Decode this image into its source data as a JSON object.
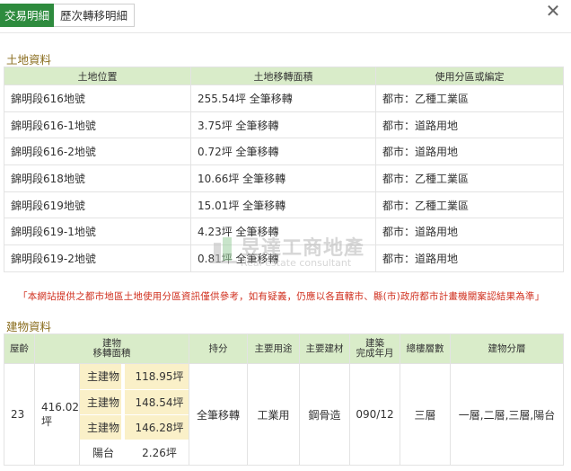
{
  "tabs": [
    {
      "label": "交易明細",
      "active": true
    },
    {
      "label": "歷次轉移明細",
      "active": false
    }
  ],
  "close_icon": "close-icon",
  "land_section": {
    "title": "土地資料",
    "columns": [
      "土地位置",
      "土地移轉面積",
      "使用分區或編定"
    ],
    "rows": [
      {
        "location": "錦明段616地號",
        "area": "255.54坪 全筆移轉",
        "zoning": "都市：乙種工業區"
      },
      {
        "location": "錦明段616-1地號",
        "area": "3.75坪 全筆移轉",
        "zoning": "都市：道路用地"
      },
      {
        "location": "錦明段616-2地號",
        "area": "0.72坪 全筆移轉",
        "zoning": "都市：道路用地"
      },
      {
        "location": "錦明段618地號",
        "area": "10.66坪 全筆移轉",
        "zoning": "都市：乙種工業區"
      },
      {
        "location": "錦明段619地號",
        "area": "15.01坪 全筆移轉",
        "zoning": "都市：乙種工業區"
      },
      {
        "location": "錦明段619-1地號",
        "area": "4.23坪 全筆移轉",
        "zoning": "都市：道路用地"
      },
      {
        "location": "錦明段619-2地號",
        "area": "0.81坪 全筆移轉",
        "zoning": "都市：道路用地"
      }
    ]
  },
  "notice": "「本網站提供之都市地區土地使用分區資訊僅供參考，如有疑義，仍應以各直轄市、縣(市)政府都市計畫機關案認結果為準」",
  "watermark": {
    "name": "昱達工商地產",
    "subtitle": "Real estate consultant"
  },
  "building_section": {
    "title": "建物資料",
    "columns": {
      "age": "屋齡",
      "area_top": "建物",
      "area_bottom": "移轉面積",
      "share": "持分",
      "usage": "主要用途",
      "material": "主要建材",
      "completed_top": "建築",
      "completed_bottom": "完成年月",
      "floors": "總樓層數",
      "floor_split": "建物分層"
    },
    "row": {
      "age": "23",
      "total_area": "416.02坪",
      "sub_areas": [
        {
          "type": "主建物",
          "area": "118.95坪"
        },
        {
          "type": "主建物",
          "area": "148.54坪"
        },
        {
          "type": "主建物",
          "area": "146.28坪"
        },
        {
          "type": "陽台",
          "area": "2.26坪"
        }
      ],
      "share": "全筆移轉",
      "usage": "工業用",
      "material": "鋼骨造",
      "completed": "090/12",
      "floors": "三層",
      "floor_split": "一層,二層,三層,陽台"
    }
  }
}
